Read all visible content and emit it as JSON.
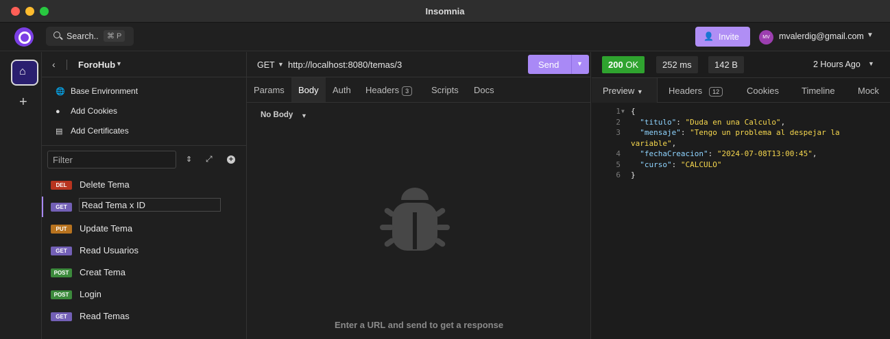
{
  "window": {
    "title": "Insomnia"
  },
  "header": {
    "search_label": "Search..",
    "search_shortcut": "⌘ P",
    "invite_label": "Invite",
    "avatar_initials": "MV",
    "user_email": "mvalerdig@gmail.com"
  },
  "sidebar": {
    "project": "ForoHub",
    "options": [
      {
        "label": "Base Environment",
        "icon": "globe-icon"
      },
      {
        "label": "Add Cookies",
        "icon": "cookie-icon"
      },
      {
        "label": "Add Certificates",
        "icon": "certificate-icon"
      }
    ],
    "filter_placeholder": "Filter",
    "requests": [
      {
        "method": "DEL",
        "name": "Delete Tema",
        "color": "#c0392b"
      },
      {
        "method": "GET",
        "name": "Read Tema x ID",
        "color": "#7360b6",
        "active": true
      },
      {
        "method": "PUT",
        "name": "Update Tema",
        "color": "#b8731f"
      },
      {
        "method": "GET",
        "name": "Read Usuarios",
        "color": "#7360b6"
      },
      {
        "method": "POST",
        "name": "Creat Tema",
        "color": "#3c8a3c"
      },
      {
        "method": "POST",
        "name": "Login",
        "color": "#3c8a3c"
      },
      {
        "method": "GET",
        "name": "Read Temas",
        "color": "#7360b6"
      }
    ]
  },
  "request": {
    "method": "GET",
    "url": "http://localhost:8080/temas/3",
    "send_label": "Send",
    "tabs": {
      "params": "Params",
      "body": "Body",
      "auth": "Auth",
      "headers": "Headers",
      "headers_count": "3",
      "scripts": "Scripts",
      "docs": "Docs"
    },
    "body_type": "No Body",
    "empty_hint": "Enter a URL and send to get a response"
  },
  "response": {
    "status_code": "200",
    "status_text": "OK",
    "time": "252 ms",
    "size": "142 B",
    "received": "2 Hours Ago",
    "tabs": {
      "preview": "Preview",
      "headers": "Headers",
      "headers_count": "12",
      "cookies": "Cookies",
      "timeline": "Timeline",
      "mock": "Mock"
    },
    "lines": {
      "n1": "1",
      "n2": "2",
      "n3": "3",
      "n4": "4",
      "n5": "5",
      "n6": "6",
      "open": "{",
      "k_titulo": "\"titulo\"",
      "v_titulo": "\"Duda en una Calculo\"",
      "k_mensaje": "\"mensaje\"",
      "v_mensaje_a": "\"Tengo un problema al despejar la",
      "v_mensaje_b": "variable\"",
      "k_fecha": "\"fechaCreacion\"",
      "v_fecha": "\"2024-07-08T13:00:45\"",
      "k_curso": "\"curso\"",
      "v_curso": "\"CALCULO\"",
      "close": "}"
    }
  },
  "colors": {
    "accent": "#a989f6",
    "status_ok": "#2fa32f",
    "json_key": "#8fd4ff",
    "json_string": "#f6d74e"
  }
}
